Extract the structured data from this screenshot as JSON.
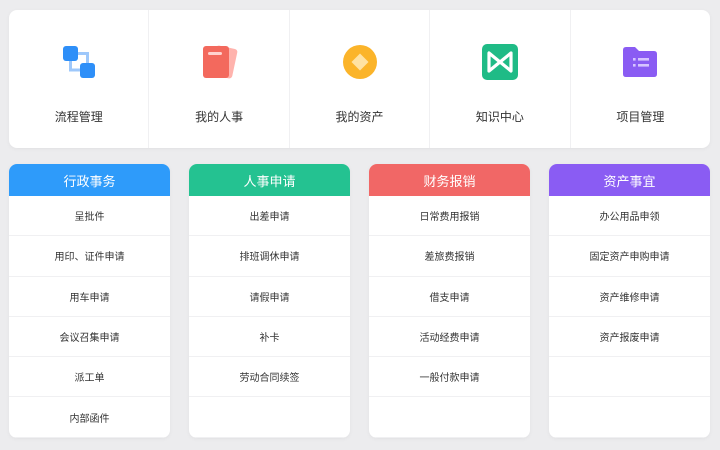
{
  "top_nav": [
    {
      "label": "流程管理",
      "icon": "flow-icon"
    },
    {
      "label": "我的人事",
      "icon": "document-icon"
    },
    {
      "label": "我的资产",
      "icon": "coin-icon"
    },
    {
      "label": "知识中心",
      "icon": "knowledge-icon"
    },
    {
      "label": "项目管理",
      "icon": "folder-icon"
    }
  ],
  "columns": [
    {
      "title": "行政事务",
      "color": "#2e9bfa",
      "items": [
        "呈批件",
        "用印、证件申请",
        "用车申请",
        "会议召集申请",
        "派工单",
        "内部函件"
      ]
    },
    {
      "title": "人事申请",
      "color": "#24c291",
      "items": [
        "出差申请",
        "排班调休申请",
        "请假申请",
        "补卡",
        "劳动合同续签",
        ""
      ]
    },
    {
      "title": "财务报销",
      "color": "#f16766",
      "items": [
        "日常费用报销",
        "差旅费报销",
        "借支申请",
        "活动经费申请",
        "一般付款申请",
        ""
      ]
    },
    {
      "title": "资产事宜",
      "color": "#8a5cf3",
      "items": [
        "办公用品申领",
        "固定资产申购申请",
        "资产维修申请",
        "资产报废申请",
        "",
        ""
      ]
    }
  ]
}
